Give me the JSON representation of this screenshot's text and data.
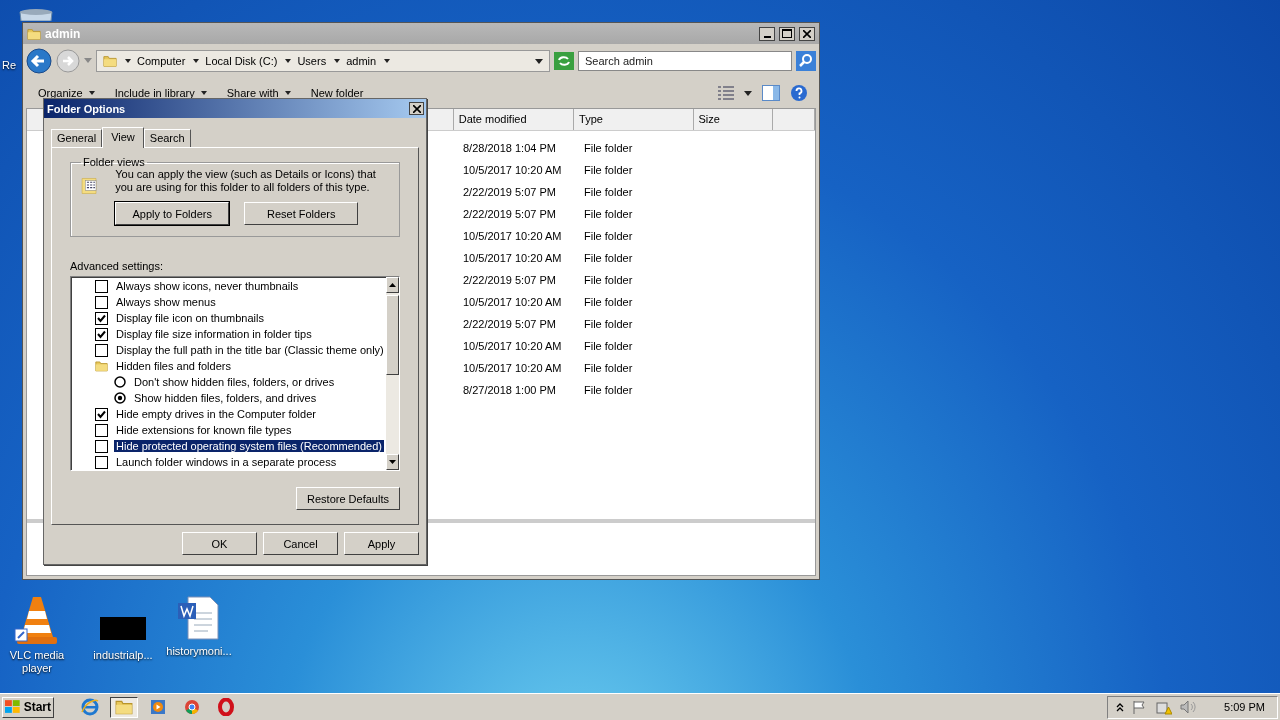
{
  "desktop_icons": [
    {
      "kind": "recycle",
      "label": "Re"
    },
    {
      "kind": "vlc",
      "label": "VLC media player"
    },
    {
      "kind": "black",
      "label": "industrialp..."
    },
    {
      "kind": "word",
      "label": "historymoni..."
    }
  ],
  "explorer": {
    "title": "admin",
    "breadcrumbs": [
      "Computer",
      "Local Disk (C:)",
      "Users",
      "admin"
    ],
    "search": {
      "placeholder": "Search admin"
    },
    "toolbar": [
      "Organize",
      "Include in library",
      "Share with",
      "New folder"
    ],
    "columns": [
      "Date modified",
      "Type",
      "Size"
    ],
    "rows": [
      {
        "date": "8/28/2018 1:04 PM",
        "type": "File folder"
      },
      {
        "date": "10/5/2017 10:20 AM",
        "type": "File folder"
      },
      {
        "date": "2/22/2019 5:07 PM",
        "type": "File folder"
      },
      {
        "date": "2/22/2019 5:07 PM",
        "type": "File folder"
      },
      {
        "date": "10/5/2017 10:20 AM",
        "type": "File folder"
      },
      {
        "date": "10/5/2017 10:20 AM",
        "type": "File folder"
      },
      {
        "date": "2/22/2019 5:07 PM",
        "type": "File folder"
      },
      {
        "date": "10/5/2017 10:20 AM",
        "type": "File folder"
      },
      {
        "date": "2/22/2019 5:07 PM",
        "type": "File folder"
      },
      {
        "date": "10/5/2017 10:20 AM",
        "type": "File folder"
      },
      {
        "date": "10/5/2017 10:20 AM",
        "type": "File folder"
      },
      {
        "date": "8/27/2018 1:00 PM",
        "type": "File folder"
      }
    ]
  },
  "dialog": {
    "title": "Folder Options",
    "tabs": [
      {
        "label": "General",
        "selected": false
      },
      {
        "label": "View",
        "selected": true
      },
      {
        "label": "Search",
        "selected": false
      }
    ],
    "group_title": "Folder views",
    "description": "You can apply the view (such as Details or Icons) that you are using for this folder to all folders of this type.",
    "group_buttons": [
      {
        "label": "Apply to Folders",
        "default": true
      },
      {
        "label": "Reset Folders",
        "default": false
      }
    ],
    "advanced_label": "Advanced settings:",
    "settings": [
      {
        "kind": "checkbox",
        "label": "Always show icons, never thumbnails",
        "checked": false,
        "selected": false
      },
      {
        "kind": "checkbox",
        "label": "Always show menus",
        "checked": false,
        "selected": false
      },
      {
        "kind": "checkbox",
        "label": "Display file icon on thumbnails",
        "checked": true,
        "selected": false
      },
      {
        "kind": "checkbox",
        "label": "Display file size information in folder tips",
        "checked": true,
        "selected": false
      },
      {
        "kind": "checkbox",
        "label": "Display the full path in the title bar (Classic theme only)",
        "checked": false,
        "selected": false
      },
      {
        "kind": "folder",
        "label": "Hidden files and folders",
        "selected": false,
        "children": [
          {
            "kind": "radio",
            "label": "Don't show hidden files, folders, or drives",
            "checked": false,
            "selected": false
          },
          {
            "kind": "radio",
            "label": "Show hidden files, folders, and drives",
            "checked": true,
            "selected": false
          }
        ]
      },
      {
        "kind": "checkbox",
        "label": "Hide empty drives in the Computer folder",
        "checked": true,
        "selected": false
      },
      {
        "kind": "checkbox",
        "label": "Hide extensions for known file types",
        "checked": false,
        "selected": false
      },
      {
        "kind": "checkbox",
        "label": "Hide protected operating system files (Recommended)",
        "checked": false,
        "selected": true
      },
      {
        "kind": "checkbox",
        "label": "Launch folder windows in a separate process",
        "checked": false,
        "selected": false
      }
    ],
    "restore_button": "Restore Defaults",
    "buttons": [
      "OK",
      "Cancel",
      "Apply"
    ]
  },
  "taskbar": {
    "start": "Start",
    "apps": [
      {
        "kind": "ie",
        "selected": false
      },
      {
        "kind": "explorer",
        "selected": true
      },
      {
        "kind": "media",
        "selected": false
      },
      {
        "kind": "chrome",
        "selected": false
      },
      {
        "kind": "opera",
        "selected": false
      }
    ],
    "clock": "5:09 PM"
  }
}
